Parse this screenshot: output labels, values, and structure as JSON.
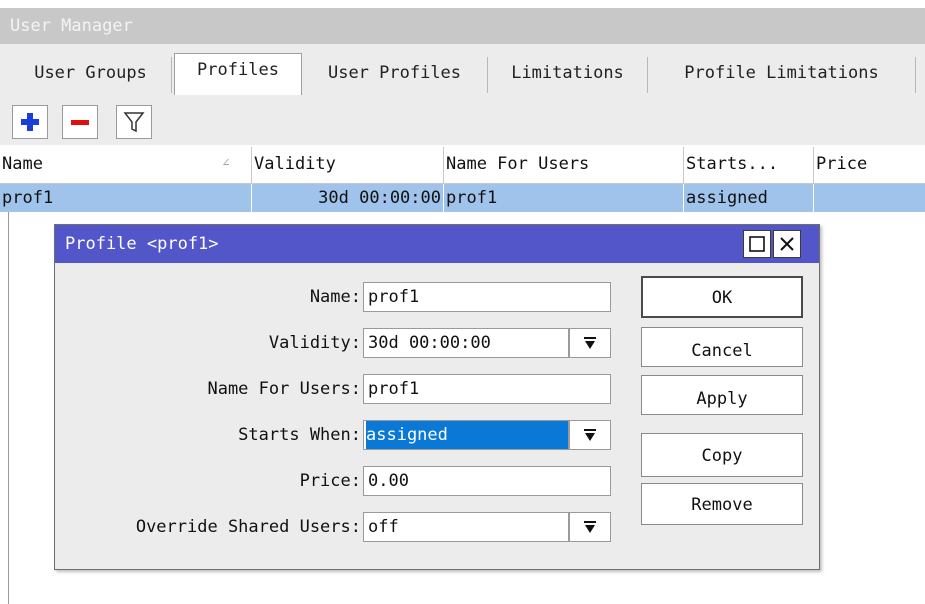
{
  "window": {
    "title": "User Manager"
  },
  "tabs": [
    {
      "label": "User Groups",
      "active": false
    },
    {
      "label": "Profiles",
      "active": true
    },
    {
      "label": "User Profiles",
      "active": false
    },
    {
      "label": "Limitations",
      "active": false
    },
    {
      "label": "Profile Limitations",
      "active": false
    }
  ],
  "toolbar": {
    "add_icon": "plus-icon",
    "remove_icon": "minus-icon",
    "filter_icon": "filter-icon",
    "add_color": "#1a3ed8",
    "remove_color": "#e01010"
  },
  "table": {
    "columns": [
      "Name",
      "Validity",
      "Name For Users",
      "Starts...",
      "Price"
    ],
    "sort_indicator": "∠",
    "rows": [
      {
        "name": "prof1",
        "validity": "30d 00:00:00",
        "name_for_users": "prof1",
        "starts": "assigned",
        "price": ""
      }
    ]
  },
  "dialog": {
    "title": "Profile <prof1>",
    "fields": {
      "name": {
        "label": "Name:",
        "value": "prof1"
      },
      "validity": {
        "label": "Validity:",
        "value": "30d 00:00:00"
      },
      "name_for_users": {
        "label": "Name For Users:",
        "value": "prof1"
      },
      "starts_when": {
        "label": "Starts When:",
        "value": "assigned"
      },
      "price": {
        "label": "Price:",
        "value": "0.00"
      },
      "override_shared_users": {
        "label": "Override Shared Users:",
        "value": "off"
      }
    },
    "buttons": {
      "ok": "OK",
      "cancel": "Cancel",
      "apply": "Apply",
      "copy": "Copy",
      "remove": "Remove"
    },
    "title_color": "#5256c8"
  }
}
